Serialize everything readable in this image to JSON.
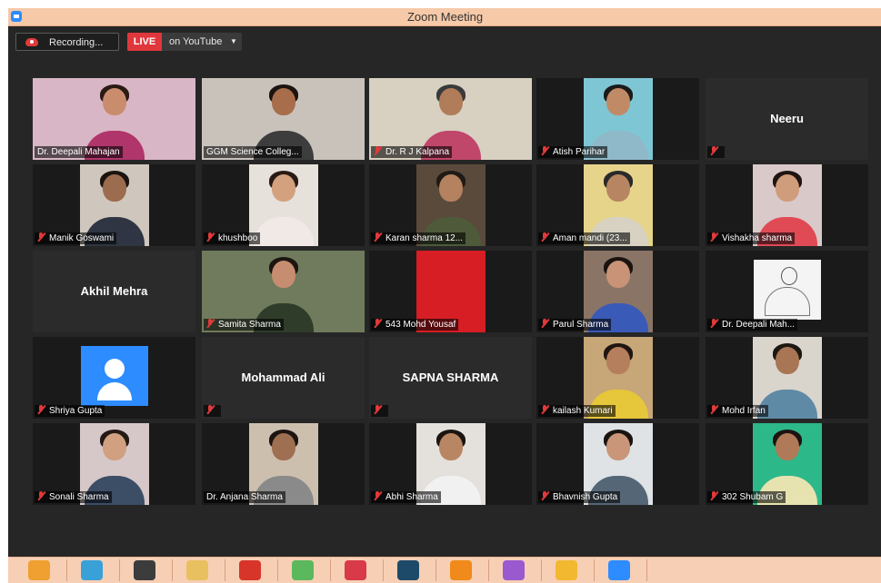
{
  "window": {
    "title": "Zoom Meeting"
  },
  "toolbar": {
    "recording_label": "Recording...",
    "live_badge": "LIVE",
    "live_target": "on YouTube",
    "live_dropdown_icon": "caret-down-icon"
  },
  "participants": [
    {
      "name": "Dr. Deepali Mahajan",
      "video": true,
      "muted": false,
      "active_speaker": true
    },
    {
      "name": "GGM Science Colleg...",
      "video": true,
      "muted": false
    },
    {
      "name": "Dr. R J Kalpana",
      "video": true,
      "muted": true
    },
    {
      "name": "Atish Parihar",
      "video": true,
      "muted": true
    },
    {
      "name": "Neeru",
      "video": false,
      "muted": true,
      "display_name": "Neeru"
    },
    {
      "name": "Manik Goswami",
      "video": true,
      "muted": true
    },
    {
      "name": "khushboo",
      "video": true,
      "muted": true
    },
    {
      "name": "Karan sharma 12...",
      "video": true,
      "muted": true
    },
    {
      "name": "Aman mandi (23...",
      "video": true,
      "muted": true
    },
    {
      "name": "Vishakha sharma",
      "video": true,
      "muted": true
    },
    {
      "name": "Akhil Mehra",
      "video": false,
      "muted": false,
      "display_name": "Akhil Mehra"
    },
    {
      "name": "Samita Sharma",
      "video": true,
      "muted": true
    },
    {
      "name": "543 Mohd Yousaf",
      "video": true,
      "muted": true
    },
    {
      "name": "Parul Sharma",
      "video": true,
      "muted": true
    },
    {
      "name": "Dr. Deepali Mah...",
      "video": true,
      "muted": true
    },
    {
      "name": "Shriya Gupta",
      "video": true,
      "muted": true
    },
    {
      "name": "Mohammad Ali",
      "video": false,
      "muted": true,
      "display_name": "Mohammad Ali"
    },
    {
      "name": "SAPNA SHARMA",
      "video": false,
      "muted": true,
      "display_name": "SAPNA SHARMA"
    },
    {
      "name": "kailash Kumari",
      "video": true,
      "muted": true
    },
    {
      "name": "Mohd Irfan",
      "video": true,
      "muted": true
    },
    {
      "name": "Sonali Sharma",
      "video": true,
      "muted": true
    },
    {
      "name": "Dr. Anjana Sharma",
      "video": true,
      "muted": false
    },
    {
      "name": "Abhi Sharma",
      "video": true,
      "muted": true
    },
    {
      "name": "Bhavnish Gupta",
      "video": true,
      "muted": true
    },
    {
      "name": "302 Shubam G",
      "video": true,
      "muted": true
    }
  ],
  "taskbar": {
    "icons": [
      "audacity-icon",
      "video-editor-icon",
      "obs-icon",
      "file-explorer-icon",
      "pdf-reader-icon",
      "utorrent-icon",
      "opera-icon",
      "vegas-icon",
      "vlc-icon",
      "media-player-icon",
      "chrome-icon",
      "zoom-icon"
    ]
  },
  "colors": {
    "titlebar": "#f6c9a8",
    "meeting_bg": "#262626",
    "tile_bg": "#2b2b2b",
    "active_border": "#f2f067",
    "live_red": "#e0373d",
    "mute_red": "#e03a3a",
    "taskbar": "#f7cfb5"
  }
}
